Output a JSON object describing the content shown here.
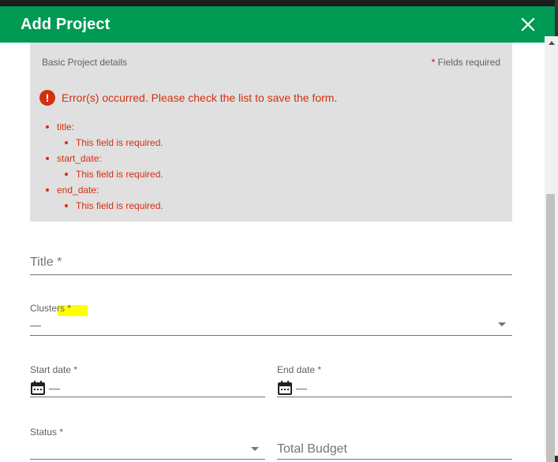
{
  "dialog": {
    "title": "Add Project",
    "close_icon": "close-icon"
  },
  "panel": {
    "heading": "Basic Project details",
    "required_star": "*",
    "required_text": " Fields required",
    "error_icon_glyph": "!",
    "error_summary": "Error(s) occurred. Please check the list to save the form.",
    "errors": [
      {
        "field": "title:",
        "message": "This field is required."
      },
      {
        "field": "start_date:",
        "message": "This field is required."
      },
      {
        "field": "end_date:",
        "message": "This field is required."
      }
    ]
  },
  "form": {
    "title_label": "Title *",
    "clusters_label": "Clusters *",
    "clusters_value": "—",
    "start_date_label": "Start date *",
    "start_date_value": "—",
    "end_date_label": "End date *",
    "end_date_value": "—",
    "status_label": "Status *",
    "total_budget_label": "Total Budget"
  },
  "colors": {
    "header": "#009a54",
    "error": "#d42f0f",
    "panel_bg": "#e0e0e0",
    "highlight": "#ffff00"
  }
}
